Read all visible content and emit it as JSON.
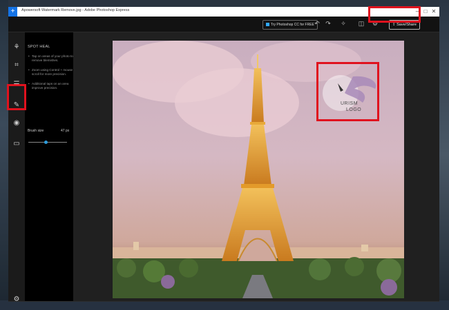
{
  "window": {
    "title": "Apowersoft Watermark Remove.jpg - Adobe Photoshop Express",
    "app_icon": "plus-icon",
    "controls": [
      "minimize-icon",
      "maximize-icon",
      "close-icon"
    ]
  },
  "toolbar": {
    "try_label": "Try Photoshop CC for FREE",
    "save_label": "Save/Share",
    "icons": [
      "undo-icon",
      "redo-icon",
      "auto-fix-icon",
      "compare-icon",
      "settings-icon"
    ]
  },
  "left_nav": {
    "items": [
      "looks-icon",
      "crop-icon",
      "adjustments-icon",
      "spot-heal-icon",
      "red-eye-icon",
      "frames-icon"
    ],
    "selected": "spot-heal-icon",
    "bottom": "settings-gear-icon"
  },
  "panel": {
    "title": "SPOT HEAL",
    "tips": [
      "Tap on areas of your photo to remove blemishes.",
      "Zoom using Control + mouse scroll for more precision.",
      "Additional taps on an area improve precision."
    ],
    "brush_label": "Brush size",
    "brush_value": "47 px",
    "brush_fraction": 0.45
  },
  "photo": {
    "watermark_text_line1": "URISM",
    "watermark_text_line2": "LOGO"
  },
  "highlight_color": "#e0121e",
  "accent_color": "#2d9cdb"
}
